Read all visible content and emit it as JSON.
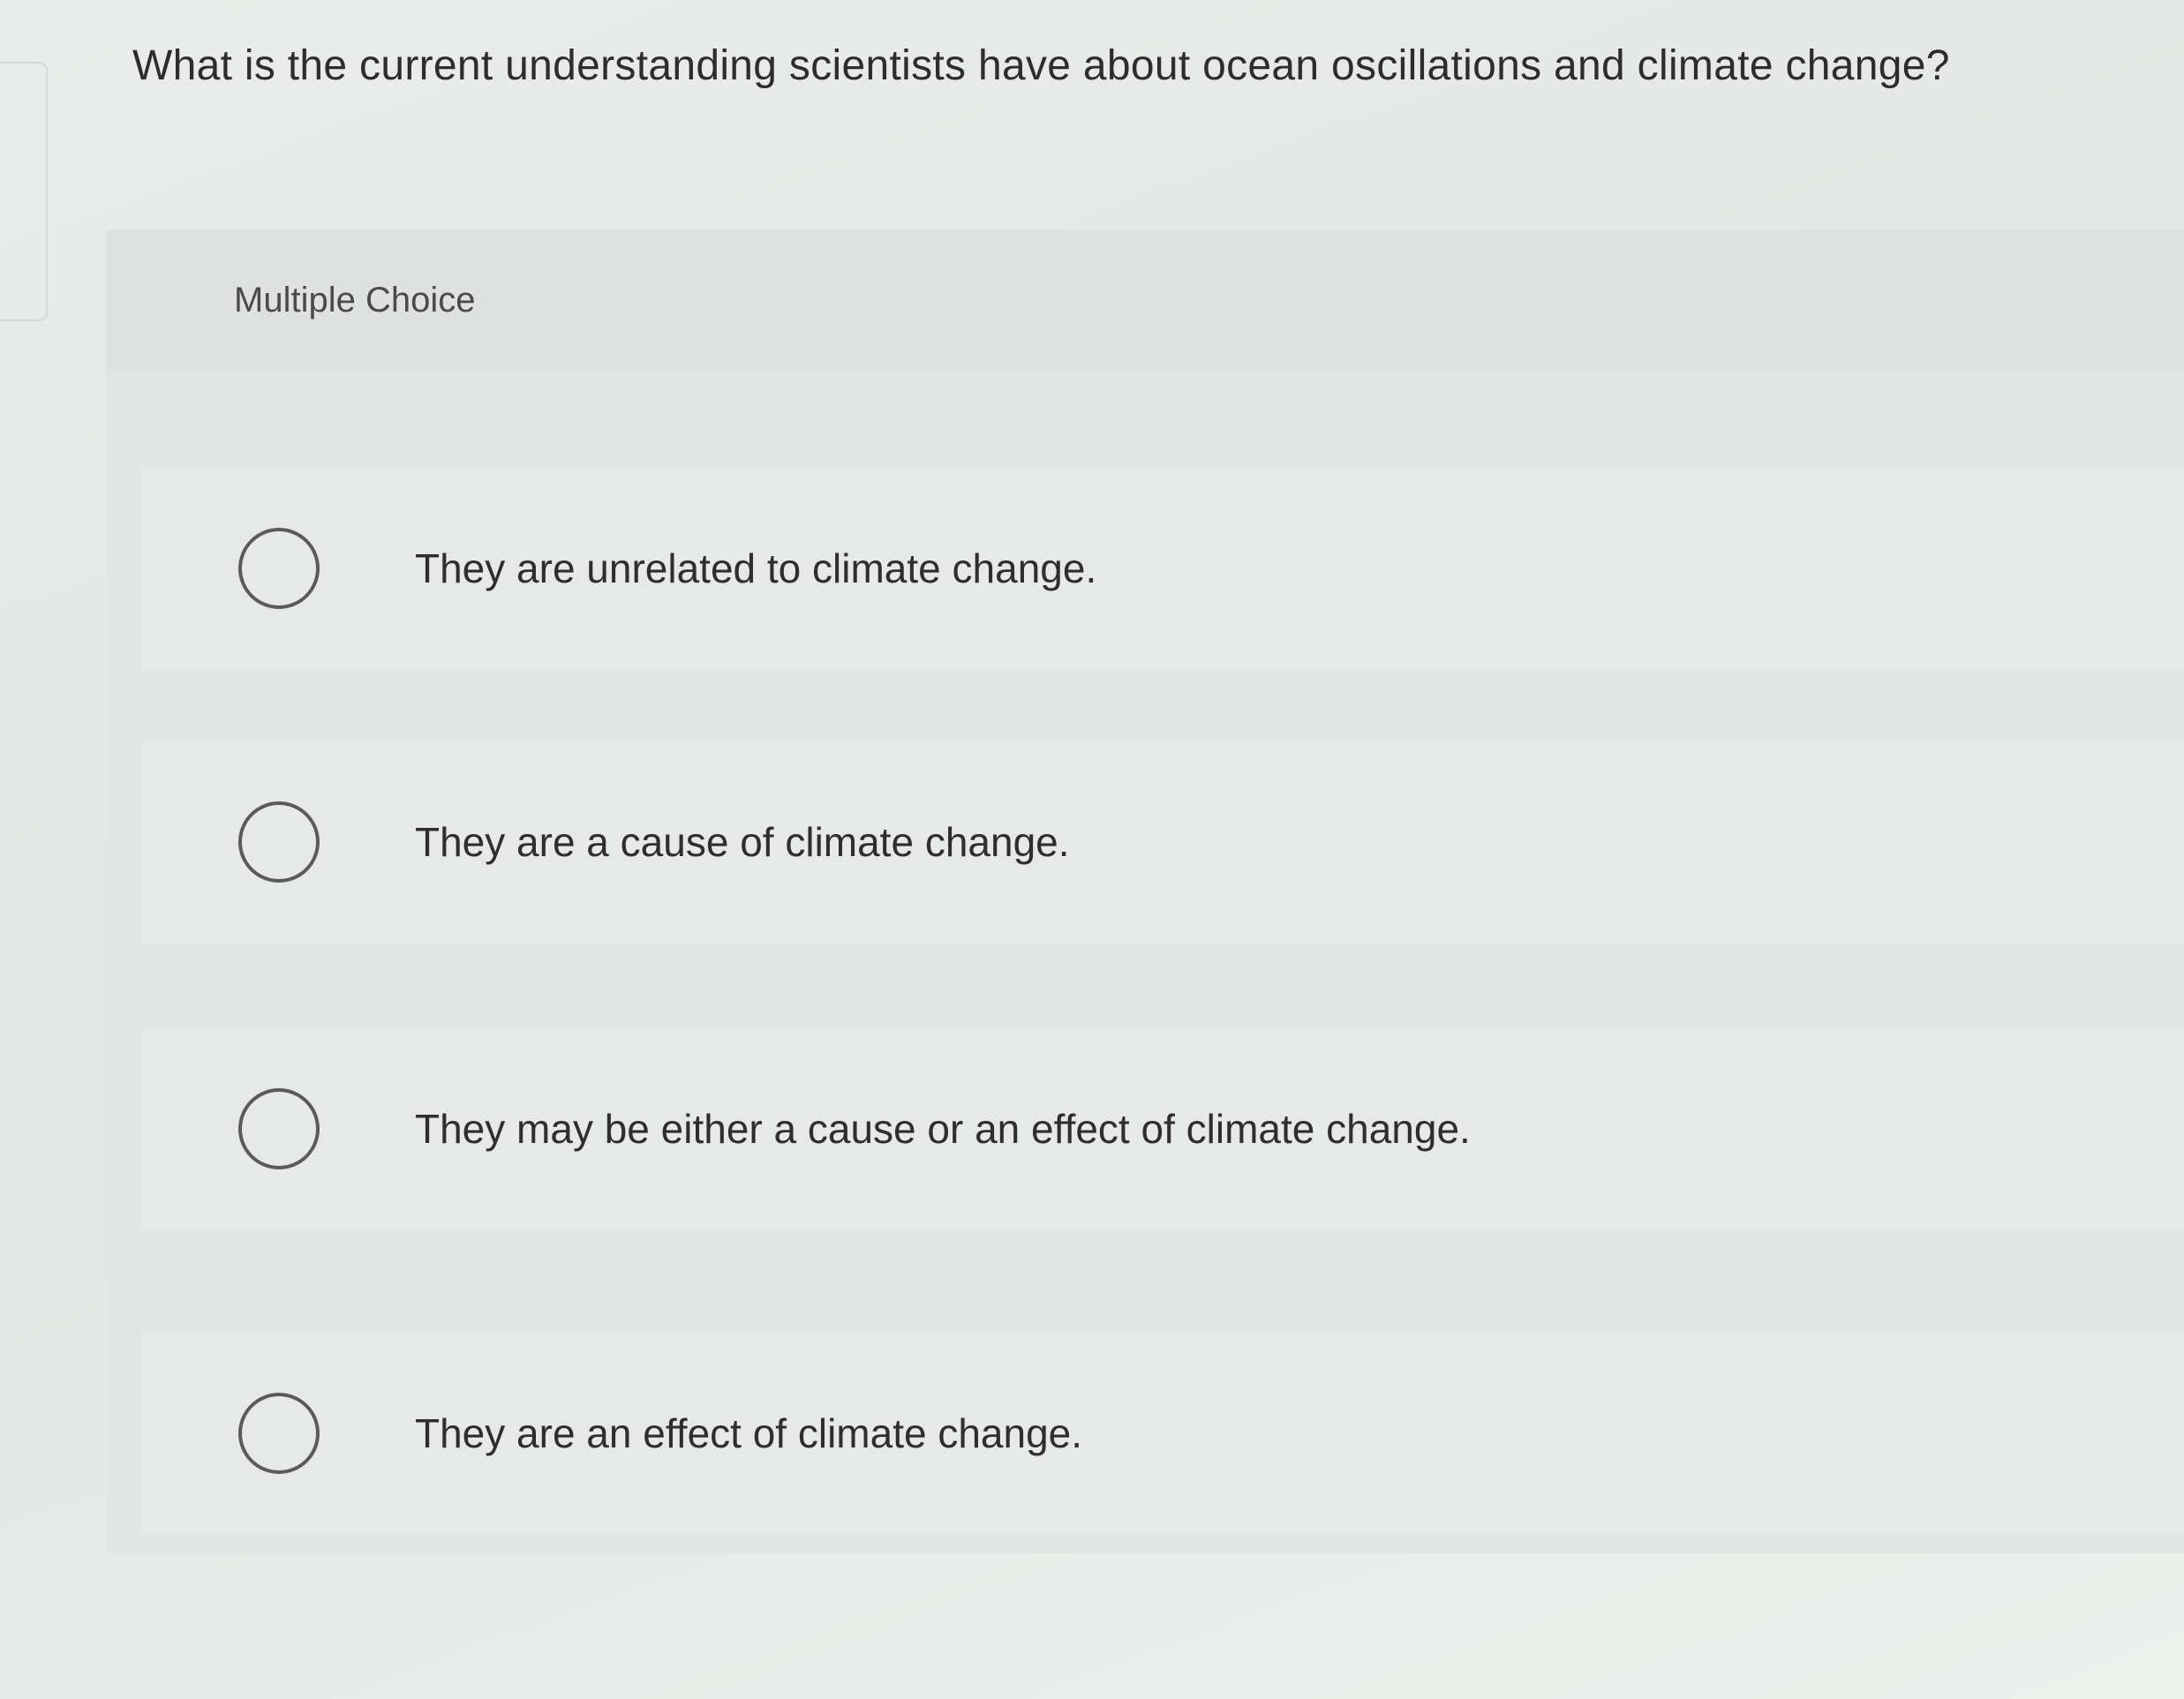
{
  "question": {
    "text": "What is the current understanding scientists have about ocean oscillations and climate change?"
  },
  "card": {
    "header_label": "Multiple Choice"
  },
  "options": [
    {
      "label": "They are unrelated to climate change.",
      "selected": false
    },
    {
      "label": "They are a cause of climate change.",
      "selected": false
    },
    {
      "label": "They may be either a cause or an effect of climate change.",
      "selected": false
    },
    {
      "label": "They are an effect of climate change.",
      "selected": false
    }
  ]
}
